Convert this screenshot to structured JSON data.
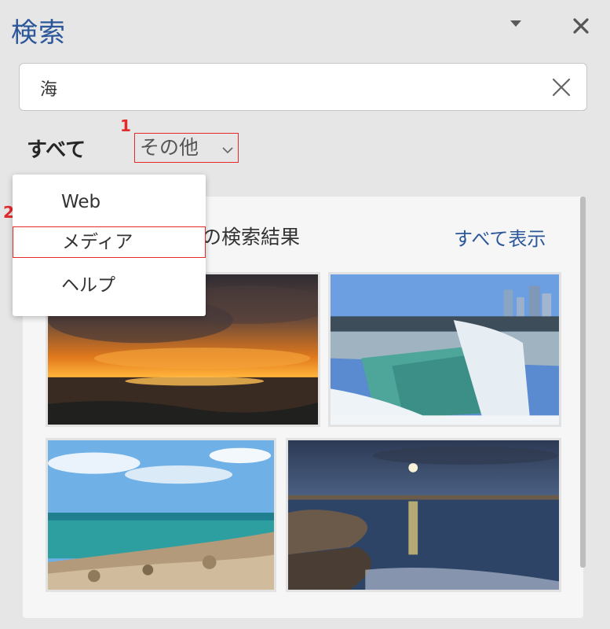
{
  "panel": {
    "title": "検索",
    "colors": {
      "title": "#2b579a",
      "callout": "#e32b2b",
      "link": "#2b579a"
    }
  },
  "search": {
    "value": "海"
  },
  "tabs": {
    "all_label": "すべて",
    "other_label": "その他"
  },
  "callouts": [
    "1",
    "2"
  ],
  "dropdown": {
    "items": [
      {
        "label": "Web"
      },
      {
        "label": "メディア"
      },
      {
        "label": "ヘルプ"
      }
    ]
  },
  "results": {
    "section_title": "の検索結果",
    "show_all_label": "すべて表示",
    "images": [
      {
        "subject": "sunset-over-sea"
      },
      {
        "subject": "frozen-waterfall-city"
      },
      {
        "subject": "turquoise-sea-rocky-shore"
      },
      {
        "subject": "moonlit-rocky-coast"
      }
    ]
  }
}
